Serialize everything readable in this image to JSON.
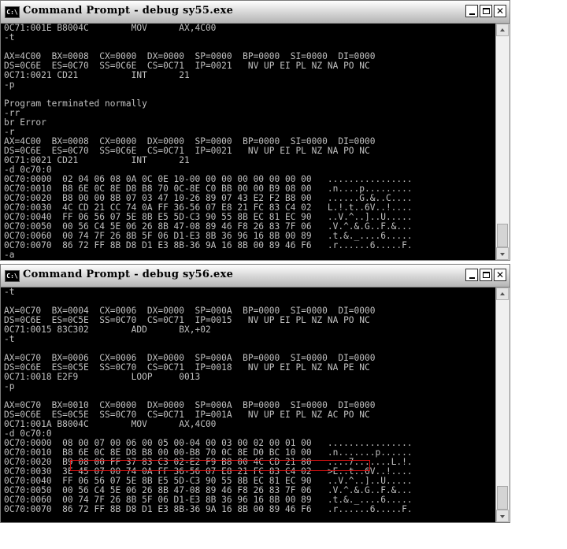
{
  "windows": [
    {
      "title": "Command Prompt - debug sy55.exe",
      "icon": "C:\\",
      "lines": [
        "0C71:001E B8004C        MOV      AX,4C00",
        "-t",
        "",
        "AX=4C00  BX=0008  CX=0000  DX=0000  SP=0000  BP=0000  SI=0000  DI=0000",
        "DS=0C6E  ES=0C70  SS=0C6E  CS=0C71  IP=0021   NV UP EI PL NZ NA PO NC",
        "0C71:0021 CD21          INT      21",
        "-p",
        "",
        "Program terminated normally",
        "-rr",
        "br Error",
        "-r",
        "AX=4C00  BX=0008  CX=0000  DX=0000  SP=0000  BP=0000  SI=0000  DI=0000",
        "DS=0C6E  ES=0C70  SS=0C6E  CS=0C71  IP=0021   NV UP EI PL NZ NA PO NC",
        "0C71:0021 CD21          INT      21",
        "-d 0c70:0",
        "0C70:0000  02 04 06 08 0A 0C 0E 10-00 00 00 00 00 00 00 00   ................",
        "0C70:0010  B8 6E 0C 8E D8 B8 70 0C-8E C0 BB 00 00 B9 08 00   .n....p.........",
        "0C70:0020  B8 00 00 8B 07 03 47 10-26 89 07 43 E2 F2 B8 00   ......G.&..C....",
        "0C70:0030  4C CD 21 CC 74 0A FF 36-56 07 E8 21 FC 83 C4 02   L.!.t..6V..!....",
        "0C70:0040  FF 06 56 07 5E 8B E5 5D-C3 90 55 8B EC 81 EC 90   ..V.^..]..U.....",
        "0C70:0050  00 56 C4 5E 06 26 8B 47-08 89 46 F8 26 83 7F 06   .V.^.&.G..F.&...",
        "0C70:0060  00 74 7F 26 8B 5F 06 D1-E3 8B 36 96 16 8B 00 89   .t.&._....6.....",
        "0C70:0070  86 72 FF 8B D8 D1 E3 8B-36 9A 16 8B 00 89 46 F6   .r......6.....F.",
        "-a"
      ]
    },
    {
      "title": "Command Prompt - debug sy56.exe",
      "icon": "C:\\",
      "lines": [
        "-t",
        "",
        "AX=0C70  BX=0004  CX=0006  DX=0000  SP=000A  BP=0000  SI=0000  DI=0000",
        "DS=0C6E  ES=0C5E  SS=0C70  CS=0C71  IP=0015   NV UP EI PL NZ NA PO NC",
        "0C71:0015 83C302        ADD      BX,+02",
        "-t",
        "",
        "AX=0C70  BX=0006  CX=0006  DX=0000  SP=000A  BP=0000  SI=0000  DI=0000",
        "DS=0C6E  ES=0C5E  SS=0C70  CS=0C71  IP=0018   NV UP EI PL NZ NA PE NC",
        "0C71:0018 E2F9          LOOP     0013",
        "-p",
        "",
        "AX=0C70  BX=0010  CX=0000  DX=0000  SP=000A  BP=0000  SI=0000  DI=0000",
        "DS=0C6E  ES=0C5E  SS=0C70  CS=0C71  IP=001A   NV UP EI PL NZ AC PO NC",
        "0C71:001A B8004C        MOV      AX,4C00",
        "-d 0c70:0",
        "0C70:0000  08 00 07 00 06 00 05 00-04 00 03 00 02 00 01 00   ................",
        "0C70:0010  B8 6E 0C 8E D8 B8 00 00-B8 70 0C 8E D0 BC 10 00   .n.......p......",
        "0C70:0020  B9 08 00 FF 37 83 C3 02-E2 F9 B8 00 4C CD 21 80   ....7.......L.!.",
        "0C70:0030  3E 45 07 00 74 0A FF 36-56 07 E8 21 FC 83 C4 02   >E..t..6V..!....",
        "0C70:0040  FF 06 56 07 5E 8B E5 5D-C3 90 55 8B EC 81 EC 90   ..V.^..]..U.....",
        "0C70:0050  00 56 C4 5E 06 26 8B 47-08 89 46 F8 26 83 7F 06   .V.^.&.G..F.&...",
        "0C70:0060  00 74 7F 26 8B 5F 06 D1-E3 8B 36 96 16 8B 00 89   .t.&._....6.....",
        "0C70:0070  86 72 FF 8B D8 D1 E3 8B-36 9A 16 8B 00 89 46 F6   .r......6.....F."
      ]
    }
  ],
  "colors": {
    "console_bg": "#000000",
    "console_text": "#c0c0c0",
    "annotation_box": "#d01010"
  }
}
